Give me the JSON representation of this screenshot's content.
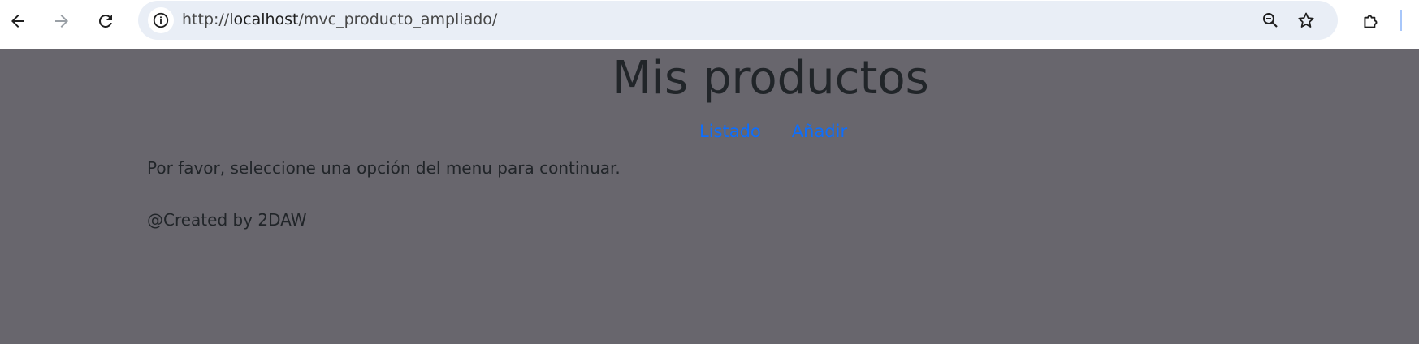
{
  "browser": {
    "url_prefix": "http://",
    "url_host": "localhost",
    "url_path": "/mvc_producto_ampliado/",
    "accent_color": "#0b57d0"
  },
  "page": {
    "title": "Mis productos",
    "menu": [
      {
        "label": "Listado"
      },
      {
        "label": "Añadir"
      }
    ],
    "message": "Por favor, seleccione una opción del menu para continuar.",
    "footer": "@Created by 2DAW",
    "background_color": "#68666d",
    "link_color": "#0d6efd"
  }
}
